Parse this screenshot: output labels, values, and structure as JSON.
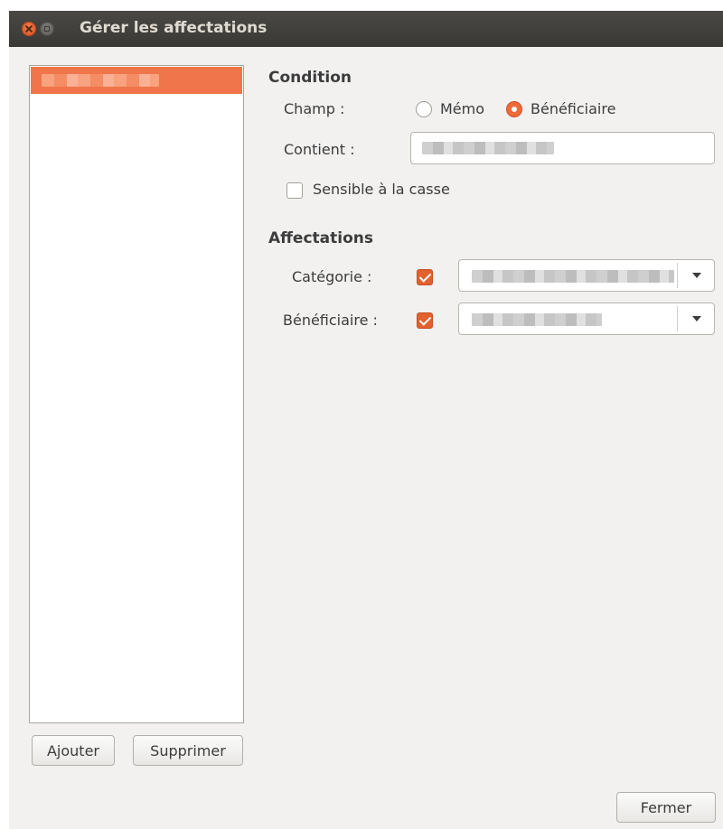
{
  "window": {
    "title": "Gérer les affectations"
  },
  "list": {
    "items": [
      {
        "label": ""
      }
    ]
  },
  "list_buttons": {
    "add_label": "Ajouter",
    "remove_label": "Supprimer"
  },
  "condition": {
    "title": "Condition",
    "field_label": "Champ :",
    "option_memo": "Mémo",
    "option_beneficiary": "Bénéficiaire",
    "selected": "Bénéficiaire",
    "contains_label": "Contient :",
    "contains_value": "",
    "case_sensitive_label": "Sensible à la casse",
    "case_sensitive": false
  },
  "assignments": {
    "title": "Affectations",
    "category_label": "Catégorie :",
    "category_enabled": true,
    "category_value": "",
    "beneficiary_label": "Bénéficiaire :",
    "beneficiary_enabled": true,
    "beneficiary_value": ""
  },
  "footer": {
    "close_label": "Fermer"
  },
  "colors": {
    "accent": "#e2612f",
    "titlebar": "#3c3b37",
    "window_bg": "#f2f1f0"
  }
}
